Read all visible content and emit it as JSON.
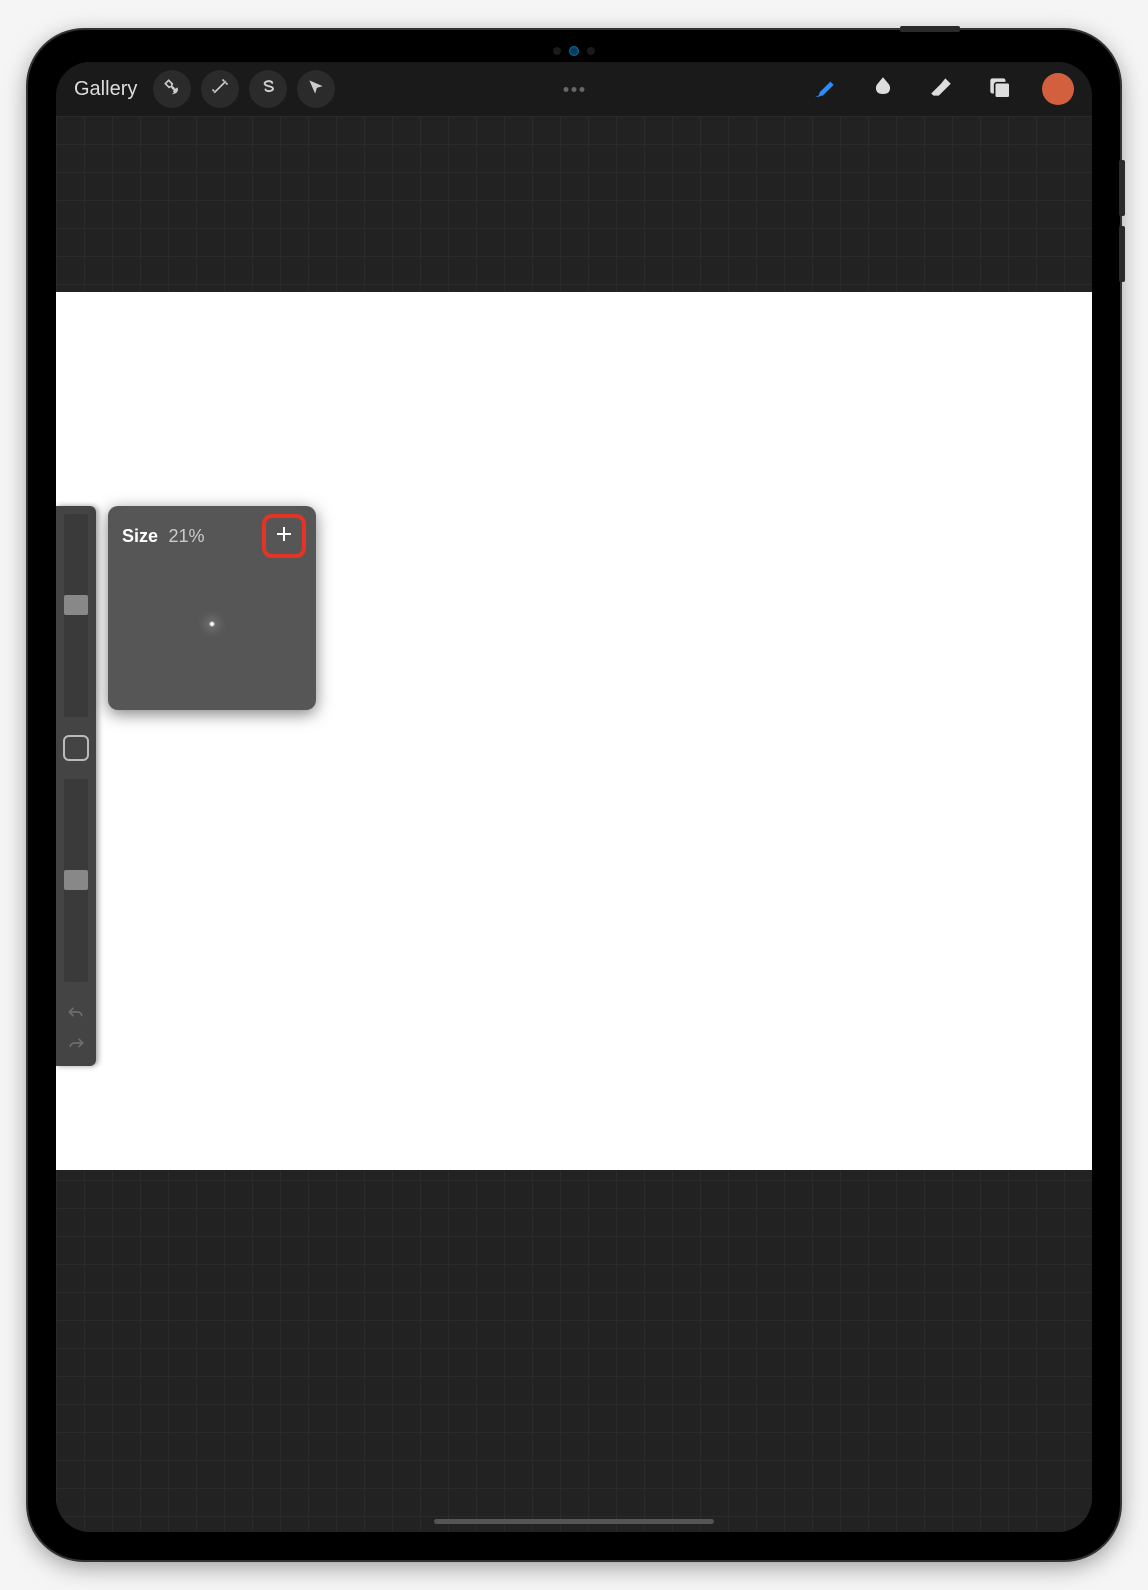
{
  "toolbar": {
    "gallery_label": "Gallery",
    "tools_left": [
      "wrench",
      "wand",
      "selection",
      "arrow"
    ],
    "tools_right": [
      "brush",
      "smudge",
      "eraser",
      "layers"
    ],
    "active_color": "#d2603f"
  },
  "size_popover": {
    "label": "Size",
    "value": "21%",
    "plus_visible": true
  },
  "sidebar": {
    "brush_size_pos_pct": 40,
    "opacity_pos_pct": 45
  }
}
